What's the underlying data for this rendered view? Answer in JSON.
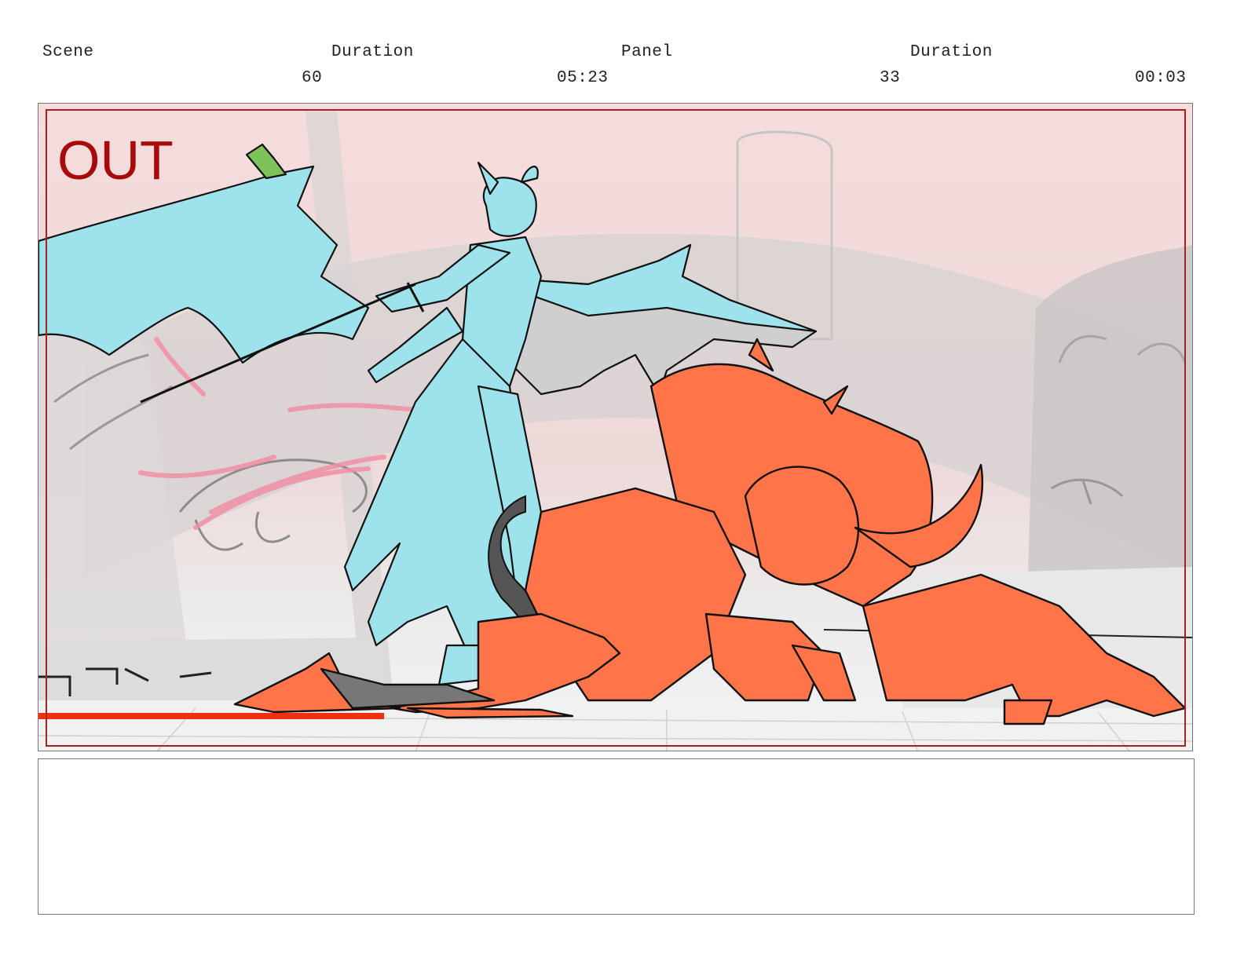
{
  "header": {
    "scene_label": "Scene",
    "scene_duration_label": "Duration",
    "panel_label": "Panel",
    "panel_duration_label": "Duration",
    "scene_value": "60",
    "scene_duration_value": "05:23",
    "panel_value": "33",
    "panel_duration_value": "00:03"
  },
  "panel": {
    "overlay_label": "OUT",
    "overlay_color": "#a80a0a",
    "safe_frame_color": "#a82020",
    "blue_character_color": "#9ee3ec",
    "orange_character_color": "#ff7448"
  },
  "notes": {
    "text": ""
  }
}
